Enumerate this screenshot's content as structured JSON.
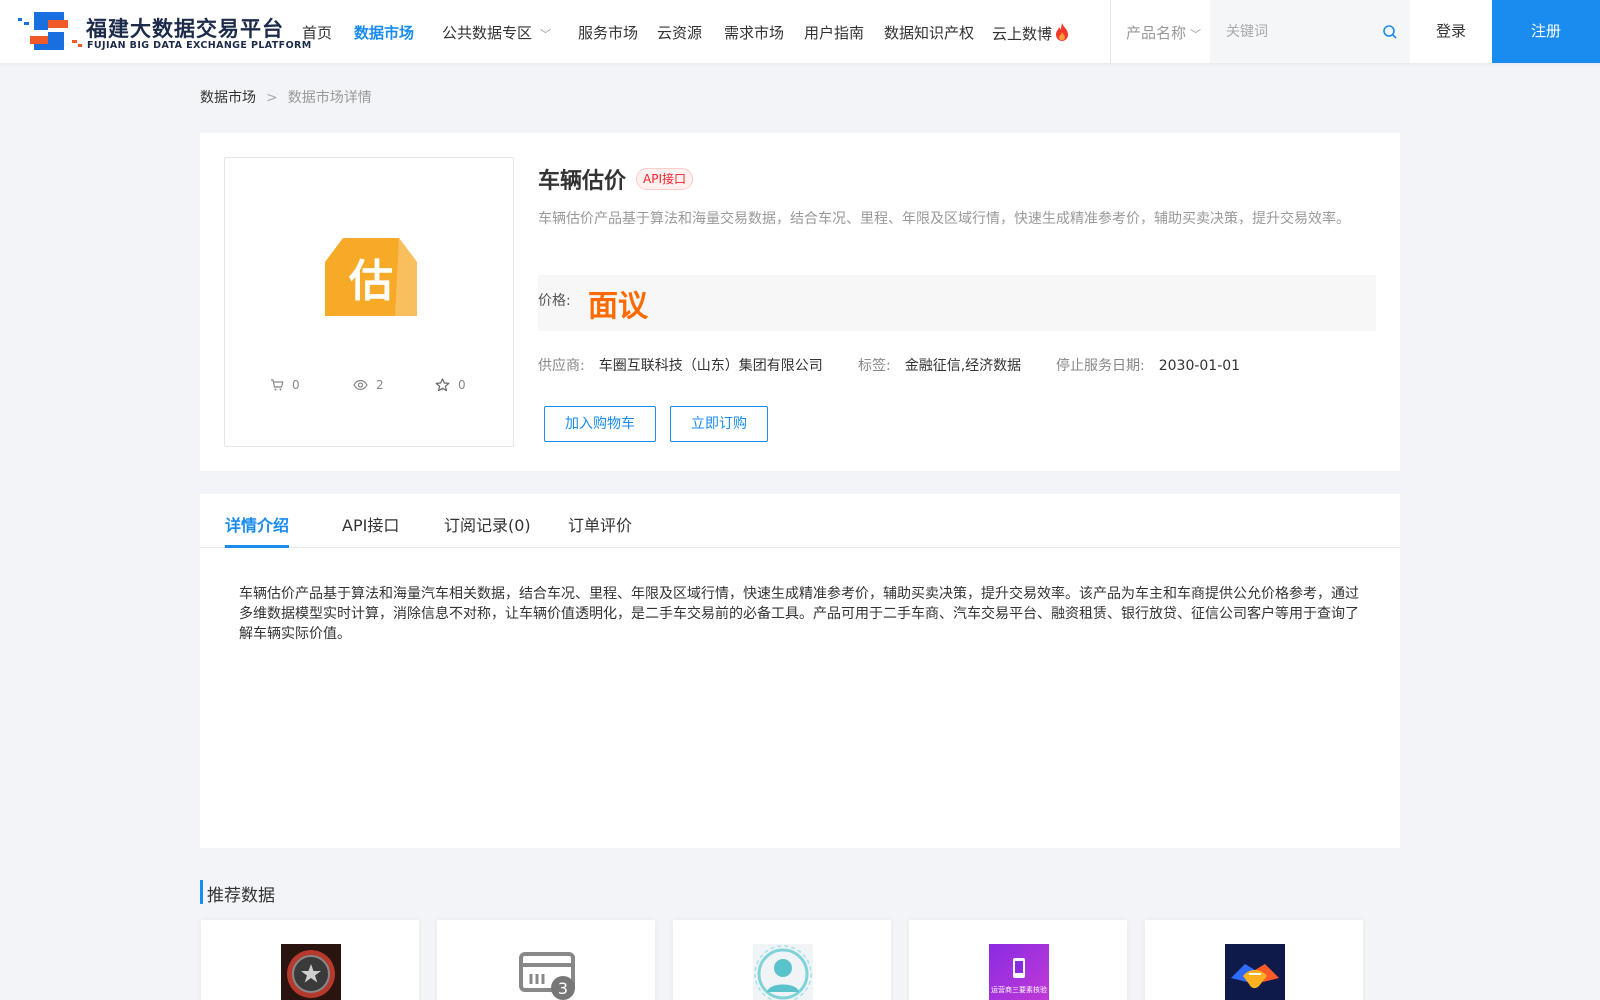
{
  "brand": {
    "name_cn": "福建大数据交易平台",
    "name_en": "FUJIAN BIG DATA EXCHANGE  PLATFORM"
  },
  "nav": {
    "items": [
      {
        "label": "首页"
      },
      {
        "label": "数据市场",
        "active": true
      },
      {
        "label": "公共数据专区",
        "has_dropdown": true
      },
      {
        "label": "服务市场"
      },
      {
        "label": "云资源"
      },
      {
        "label": "需求市场"
      },
      {
        "label": "用户指南"
      },
      {
        "label": "数据知识产权"
      },
      {
        "label": "云上数博",
        "icon": "fire-icon"
      }
    ]
  },
  "search": {
    "category": "产品名称",
    "placeholder": "关键词"
  },
  "auth": {
    "login": "登录",
    "register": "注册"
  },
  "breadcrumb": {
    "root": "数据市场",
    "separator": ">",
    "current": "数据市场详情"
  },
  "product": {
    "title": "车辆估价",
    "badge": "API接口",
    "description": "车辆估价产品基于算法和海量交易数据，结合车况、里程、年限及区域行情，快速生成精准参考价，辅助买卖决策，提升交易效率。",
    "image_char": "估",
    "stats": {
      "cart": "0",
      "views": "2",
      "favorites": "0"
    },
    "price_label": "价格:",
    "price_value": "面议",
    "supplier_label": "供应商:",
    "supplier": "车圈互联科技（山东）集团有限公司",
    "tags_label": "标签:",
    "tags": "金融征信,经济数据",
    "end_date_label": "停止服务日期:",
    "end_date": "2030-01-01",
    "add_to_cart": "加入购物车",
    "buy_now": "立即订购"
  },
  "tabs": {
    "items": [
      "详情介绍",
      "API接口",
      "订阅记录(0)",
      "订单评价"
    ],
    "active_index": 0,
    "detail_text": "车辆估价产品基于算法和海量汽车相关数据，结合车况、里程、年限及区域行情，快速生成精准参考价，辅助买卖决策，提升交易效率。该产品为车主和车商提供公允价格参考，通过多维数据模型实时计算，消除信息不对称，让车辆价值透明化，是二手车交易前的必备工具。产品可用于二手车商、汽车交易平台、融资租赁、银行放贷、征信公司客户等用于查询了解车辆实际价值。"
  },
  "recommended": {
    "title": "推荐数据",
    "items": [
      {
        "icon": "vault-icon"
      },
      {
        "icon": "card-count-icon",
        "count": "3"
      },
      {
        "icon": "face-scan-icon"
      },
      {
        "icon": "phone-verify-icon",
        "caption": "运营商三要素核验"
      },
      {
        "icon": "handshake-icon"
      }
    ]
  },
  "colors": {
    "accent": "#1a8cf0",
    "price": "#ff6a00",
    "badge_red": "#f5222d",
    "logo_orange": "#f5a623"
  }
}
